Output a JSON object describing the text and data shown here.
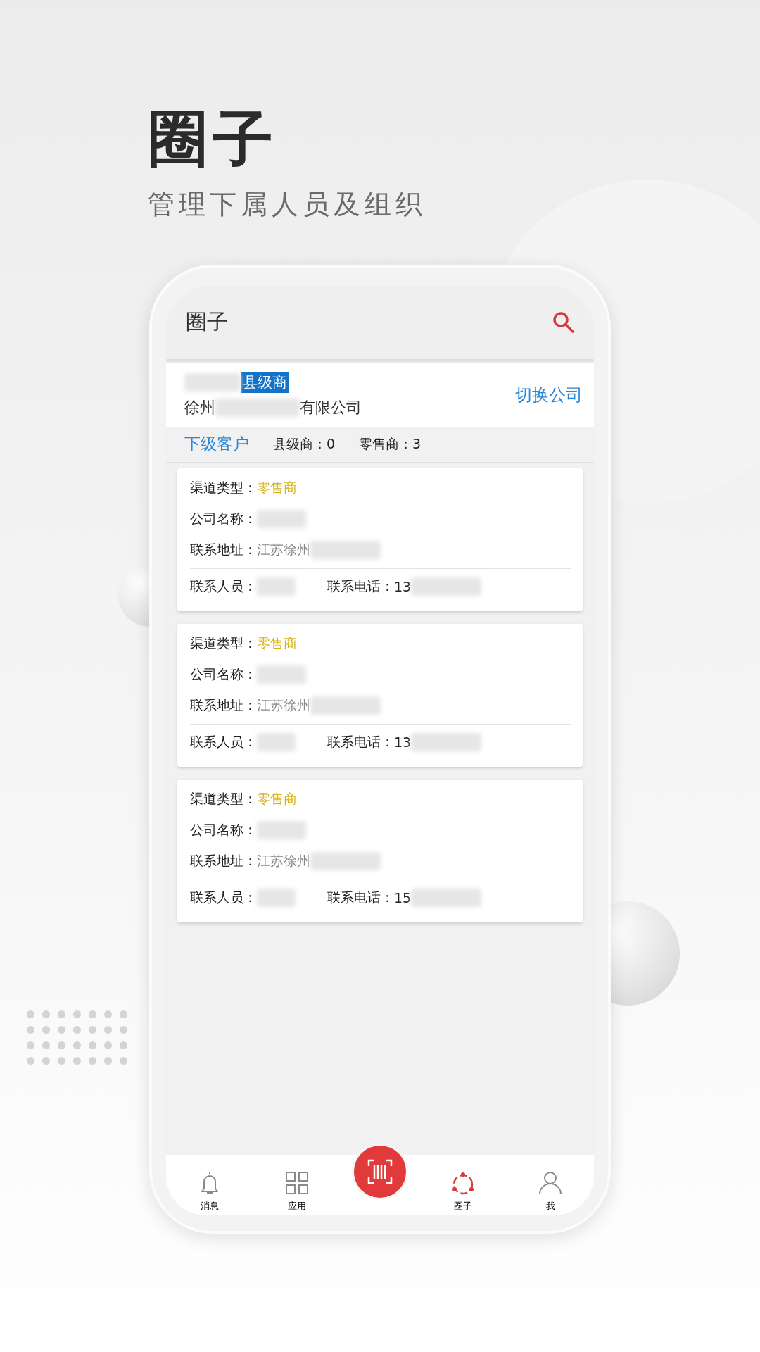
{
  "headline": {
    "title": "圈子",
    "subtitle": "管理下属人员及组织"
  },
  "app_bar": {
    "title": "圈子"
  },
  "account": {
    "level_tag": "县级商",
    "company_prefix": "徐州",
    "company_suffix": "有限公司",
    "switch_link": "切换公司"
  },
  "summary": {
    "tab": "下级客户",
    "stats": [
      "县级商：0",
      "零售商：3"
    ]
  },
  "cards": [
    {
      "type_label": "渠道类型：",
      "type_value": "零售商",
      "company_label": "公司名称：",
      "address_label": "联系地址：",
      "address_value": "江苏徐州",
      "contact_label": "联系人员：",
      "phone_label": "联系电话：",
      "phone_value": "13"
    },
    {
      "type_label": "渠道类型：",
      "type_value": "零售商",
      "company_label": "公司名称：",
      "address_label": "联系地址：",
      "address_value": "江苏徐州",
      "contact_label": "联系人员：",
      "phone_label": "联系电话：",
      "phone_value": "13"
    },
    {
      "type_label": "渠道类型：",
      "type_value": "零售商",
      "company_label": "公司名称：",
      "address_label": "联系地址：",
      "address_value": "江苏徐州",
      "contact_label": "联系人员：",
      "phone_label": "联系电话：",
      "phone_value": "15"
    }
  ],
  "nav": [
    {
      "kind": "tab",
      "label": "消息",
      "selected": false
    },
    {
      "kind": "tab",
      "label": "应用",
      "selected": false
    },
    {
      "kind": "scan",
      "selected": false
    },
    {
      "kind": "tab",
      "label": "圈子",
      "selected": true
    },
    {
      "kind": "tab",
      "label": "我",
      "selected": false
    }
  ]
}
